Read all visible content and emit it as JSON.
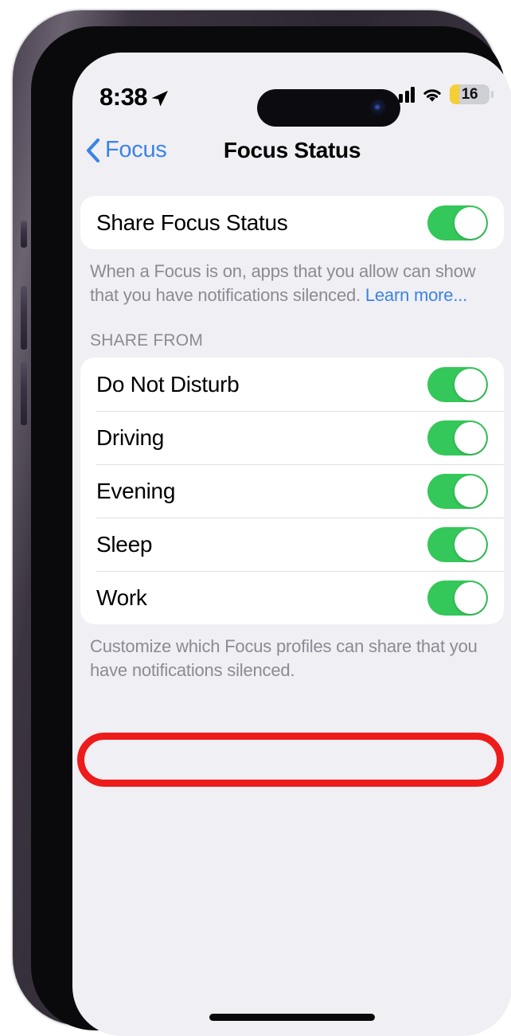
{
  "status_bar": {
    "time": "8:38",
    "location_icon": "location-arrow-icon",
    "cellular_icon": "cellular-signal-icon",
    "cellular_bars": 4,
    "wifi_icon": "wifi-icon",
    "battery_level": "16",
    "battery_low_power": true,
    "battery_color": "#f5cf33"
  },
  "nav": {
    "back_label": "Focus",
    "back_icon": "chevron-left-icon",
    "title": "Focus Status"
  },
  "share_status_section": {
    "row_label": "Share Focus Status",
    "toggle_on": true,
    "footer_text": "When a Focus is on, apps that you allow can show that you have notifications silenced. ",
    "footer_link": "Learn more..."
  },
  "share_from_section": {
    "header": "SHARE FROM",
    "rows": [
      {
        "label": "Do Not Disturb",
        "toggle_on": true
      },
      {
        "label": "Driving",
        "toggle_on": true
      },
      {
        "label": "Evening",
        "toggle_on": true
      },
      {
        "label": "Sleep",
        "toggle_on": true,
        "highlighted": true
      },
      {
        "label": "Work",
        "toggle_on": true
      }
    ],
    "footer_text": "Customize which Focus profiles can share that you have notifications silenced."
  },
  "annotation": {
    "target": "Sleep",
    "shape": "oval",
    "color": "#ee1b1b"
  },
  "theme": {
    "accent_blue": "#3a84e6",
    "toggle_green": "#34c759",
    "background": "#f0eff4",
    "card": "#ffffff",
    "secondary_text": "#8b8b93"
  }
}
